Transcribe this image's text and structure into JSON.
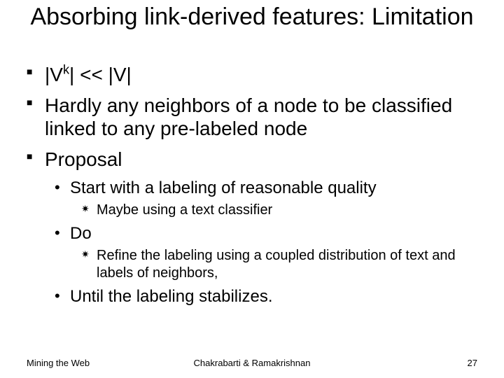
{
  "title": "Absorbing link-derived features: Limitation",
  "bullets": {
    "b1_pre": "|V",
    "b1_sup": "k",
    "b1_post": "| << |V|",
    "b2": "Hardly any neighbors of a node to be classified linked to any pre-labeled node",
    "b3": "Proposal",
    "b3a": "Start with a labeling of reasonable quality",
    "b3a1": "Maybe using a text classifier",
    "b3b": "Do",
    "b3b1": "Refine the labeling using a coupled distribution of text and labels of neighbors,",
    "b3c": "Until the labeling stabilizes."
  },
  "footer": {
    "left": "Mining the Web",
    "center": "Chakrabarti & Ramakrishnan",
    "right": "27"
  }
}
